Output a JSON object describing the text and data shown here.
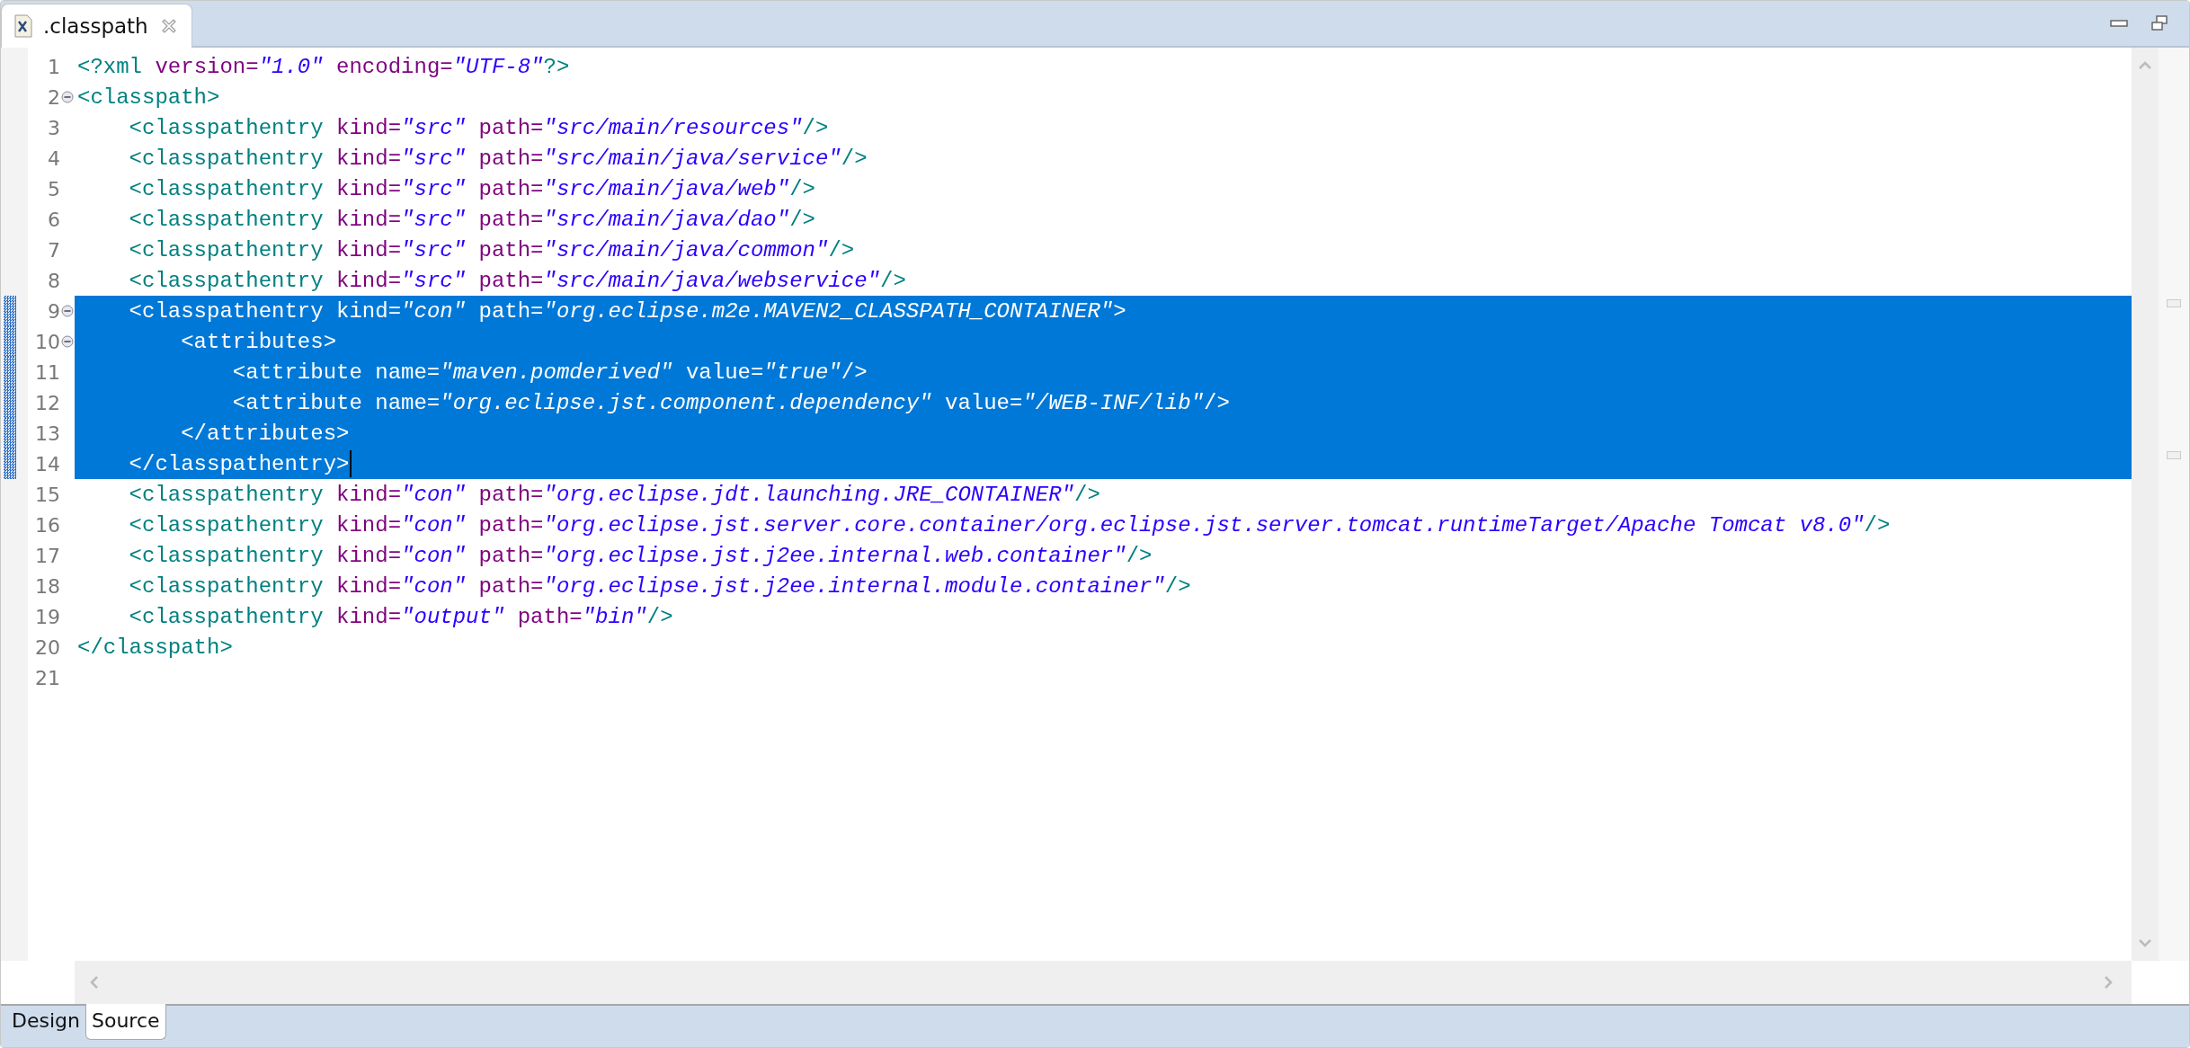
{
  "editor_tab": {
    "title": ".classpath"
  },
  "lines": [
    {
      "number": "1",
      "selected": false,
      "tokens": [
        {
          "kind": "tag",
          "text": "<?xml"
        },
        {
          "kind": "attr",
          "text": " version="
        },
        {
          "kind": "value",
          "text": "\"1.0\""
        },
        {
          "kind": "attr",
          "text": " encoding="
        },
        {
          "kind": "value",
          "text": "\"UTF-8\""
        },
        {
          "kind": "tag",
          "text": "?>"
        }
      ]
    },
    {
      "number": "2",
      "selected": false,
      "folded": false,
      "tokens": [
        {
          "kind": "tag",
          "text": "<classpath>"
        }
      ]
    },
    {
      "number": "3",
      "selected": false,
      "tokens": [
        {
          "kind": "tag",
          "text": "    <classpathentry"
        },
        {
          "kind": "attr",
          "text": " kind="
        },
        {
          "kind": "value",
          "text": "\"src\""
        },
        {
          "kind": "attr",
          "text": " path="
        },
        {
          "kind": "value",
          "text": "\"src/main/resources\""
        },
        {
          "kind": "tag",
          "text": "/>"
        }
      ]
    },
    {
      "number": "4",
      "selected": false,
      "tokens": [
        {
          "kind": "tag",
          "text": "    <classpathentry"
        },
        {
          "kind": "attr",
          "text": " kind="
        },
        {
          "kind": "value",
          "text": "\"src\""
        },
        {
          "kind": "attr",
          "text": " path="
        },
        {
          "kind": "value",
          "text": "\"src/main/java/service\""
        },
        {
          "kind": "tag",
          "text": "/>"
        }
      ]
    },
    {
      "number": "5",
      "selected": false,
      "tokens": [
        {
          "kind": "tag",
          "text": "    <classpathentry"
        },
        {
          "kind": "attr",
          "text": " kind="
        },
        {
          "kind": "value",
          "text": "\"src\""
        },
        {
          "kind": "attr",
          "text": " path="
        },
        {
          "kind": "value",
          "text": "\"src/main/java/web\""
        },
        {
          "kind": "tag",
          "text": "/>"
        }
      ]
    },
    {
      "number": "6",
      "selected": false,
      "tokens": [
        {
          "kind": "tag",
          "text": "    <classpathentry"
        },
        {
          "kind": "attr",
          "text": " kind="
        },
        {
          "kind": "value",
          "text": "\"src\""
        },
        {
          "kind": "attr",
          "text": " path="
        },
        {
          "kind": "value",
          "text": "\"src/main/java/dao\""
        },
        {
          "kind": "tag",
          "text": "/>"
        }
      ]
    },
    {
      "number": "7",
      "selected": false,
      "tokens": [
        {
          "kind": "tag",
          "text": "    <classpathentry"
        },
        {
          "kind": "attr",
          "text": " kind="
        },
        {
          "kind": "value",
          "text": "\"src\""
        },
        {
          "kind": "attr",
          "text": " path="
        },
        {
          "kind": "value",
          "text": "\"src/main/java/common\""
        },
        {
          "kind": "tag",
          "text": "/>"
        }
      ]
    },
    {
      "number": "8",
      "selected": false,
      "tokens": [
        {
          "kind": "tag",
          "text": "    <classpathentry"
        },
        {
          "kind": "attr",
          "text": " kind="
        },
        {
          "kind": "value",
          "text": "\"src\""
        },
        {
          "kind": "attr",
          "text": " path="
        },
        {
          "kind": "value",
          "text": "\"src/main/java/webservice\""
        },
        {
          "kind": "tag",
          "text": "/>"
        }
      ]
    },
    {
      "number": "9",
      "selected": true,
      "folded": false,
      "tokens": [
        {
          "kind": "tag",
          "text": "    <classpathentry"
        },
        {
          "kind": "attr",
          "text": " kind="
        },
        {
          "kind": "value",
          "text": "\"con\""
        },
        {
          "kind": "attr",
          "text": " path="
        },
        {
          "kind": "value",
          "text": "\"org.eclipse.m2e.MAVEN2_CLASSPATH_CONTAINER\""
        },
        {
          "kind": "tag",
          "text": ">"
        }
      ]
    },
    {
      "number": "10",
      "selected": true,
      "folded": false,
      "tokens": [
        {
          "kind": "tag",
          "text": "        <attributes>"
        }
      ]
    },
    {
      "number": "11",
      "selected": true,
      "tokens": [
        {
          "kind": "tag",
          "text": "            <attribute"
        },
        {
          "kind": "attr",
          "text": " name="
        },
        {
          "kind": "value",
          "text": "\"maven.pomderived\""
        },
        {
          "kind": "attr",
          "text": " value="
        },
        {
          "kind": "value",
          "text": "\"true\""
        },
        {
          "kind": "tag",
          "text": "/>"
        }
      ]
    },
    {
      "number": "12",
      "selected": true,
      "tokens": [
        {
          "kind": "tag",
          "text": "            <attribute"
        },
        {
          "kind": "attr",
          "text": " name="
        },
        {
          "kind": "value",
          "text": "\"org.eclipse.jst.component.dependency\""
        },
        {
          "kind": "attr",
          "text": " value="
        },
        {
          "kind": "value",
          "text": "\"/WEB-INF/lib\""
        },
        {
          "kind": "tag",
          "text": "/>"
        }
      ]
    },
    {
      "number": "13",
      "selected": true,
      "tokens": [
        {
          "kind": "tag",
          "text": "        </attributes>"
        }
      ]
    },
    {
      "number": "14",
      "selected": true,
      "cursor": true,
      "tokens": [
        {
          "kind": "tag",
          "text": "    </classpathentry>"
        }
      ]
    },
    {
      "number": "15",
      "selected": false,
      "tokens": [
        {
          "kind": "tag",
          "text": "    <classpathentry"
        },
        {
          "kind": "attr",
          "text": " kind="
        },
        {
          "kind": "value",
          "text": "\"con\""
        },
        {
          "kind": "attr",
          "text": " path="
        },
        {
          "kind": "value",
          "text": "\"org.eclipse.jdt.launching.JRE_CONTAINER\""
        },
        {
          "kind": "tag",
          "text": "/>"
        }
      ]
    },
    {
      "number": "16",
      "selected": false,
      "tokens": [
        {
          "kind": "tag",
          "text": "    <classpathentry"
        },
        {
          "kind": "attr",
          "text": " kind="
        },
        {
          "kind": "value",
          "text": "\"con\""
        },
        {
          "kind": "attr",
          "text": " path="
        },
        {
          "kind": "value",
          "text": "\"org.eclipse.jst.server.core.container/org.eclipse.jst.server.tomcat.runtimeTarget/Apache Tomcat v8.0\""
        },
        {
          "kind": "tag",
          "text": "/>"
        }
      ]
    },
    {
      "number": "17",
      "selected": false,
      "tokens": [
        {
          "kind": "tag",
          "text": "    <classpathentry"
        },
        {
          "kind": "attr",
          "text": " kind="
        },
        {
          "kind": "value",
          "text": "\"con\""
        },
        {
          "kind": "attr",
          "text": " path="
        },
        {
          "kind": "value",
          "text": "\"org.eclipse.jst.j2ee.internal.web.container\""
        },
        {
          "kind": "tag",
          "text": "/>"
        }
      ]
    },
    {
      "number": "18",
      "selected": false,
      "tokens": [
        {
          "kind": "tag",
          "text": "    <classpathentry"
        },
        {
          "kind": "attr",
          "text": " kind="
        },
        {
          "kind": "value",
          "text": "\"con\""
        },
        {
          "kind": "attr",
          "text": " path="
        },
        {
          "kind": "value",
          "text": "\"org.eclipse.jst.j2ee.internal.module.container\""
        },
        {
          "kind": "tag",
          "text": "/>"
        }
      ]
    },
    {
      "number": "19",
      "selected": false,
      "tokens": [
        {
          "kind": "tag",
          "text": "    <classpathentry"
        },
        {
          "kind": "attr",
          "text": " kind="
        },
        {
          "kind": "value",
          "text": "\"output\""
        },
        {
          "kind": "attr",
          "text": " path="
        },
        {
          "kind": "value",
          "text": "\"bin\""
        },
        {
          "kind": "tag",
          "text": "/>"
        }
      ]
    },
    {
      "number": "20",
      "selected": false,
      "tokens": [
        {
          "kind": "tag",
          "text": "</classpath>"
        }
      ]
    },
    {
      "number": "21",
      "selected": false
    }
  ],
  "bottom_tabs": [
    {
      "label": "Design",
      "selected": false
    },
    {
      "label": "Source",
      "selected": true
    }
  ]
}
